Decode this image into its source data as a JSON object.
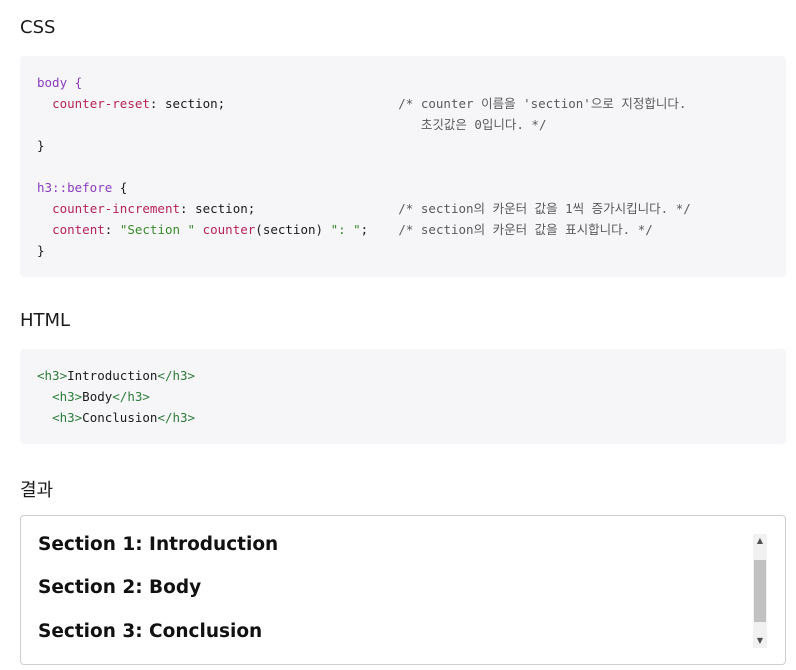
{
  "sections": {
    "css_heading": "CSS",
    "html_heading": "HTML",
    "result_heading": "결과"
  },
  "css_code": {
    "l1_sel": "body",
    "brace_open": " {",
    "l2_prop": "counter-reset",
    "l2_val": "section;",
    "l2_cmt": "/* counter 이름을 'section'으로 지정합니다.",
    "l3_cmt": "초깃값은 0입니다. */",
    "brace_close": "}",
    "l5_sel": "h3::before",
    "l6_prop": "counter-increment",
    "l6_val": "section;",
    "l6_cmt": "/* section의 카운터 값을 1씩 증가시킵니다. */",
    "l7_prop": "content",
    "l7_str1": "\"Section \"",
    "l7_fn": "counter",
    "l7_arg": "(section)",
    "l7_str2": "\": \"",
    "l7_semi": ";",
    "l7_cmt": "/* section의 카운터 값을 표시합니다. */"
  },
  "html_code": {
    "lines": [
      {
        "open": "<h3>",
        "text": "Introduction",
        "close": "</h3>"
      },
      {
        "open": "<h3>",
        "text": "Body",
        "close": "</h3>"
      },
      {
        "open": "<h3>",
        "text": "Conclusion",
        "close": "</h3>"
      }
    ]
  },
  "result": {
    "items": [
      "Section 1: Introduction",
      "Section 2: Body",
      "Section 3: Conclusion"
    ]
  },
  "icons": {
    "scroll_up": "up-arrow-icon",
    "scroll_down": "down-arrow-icon"
  }
}
